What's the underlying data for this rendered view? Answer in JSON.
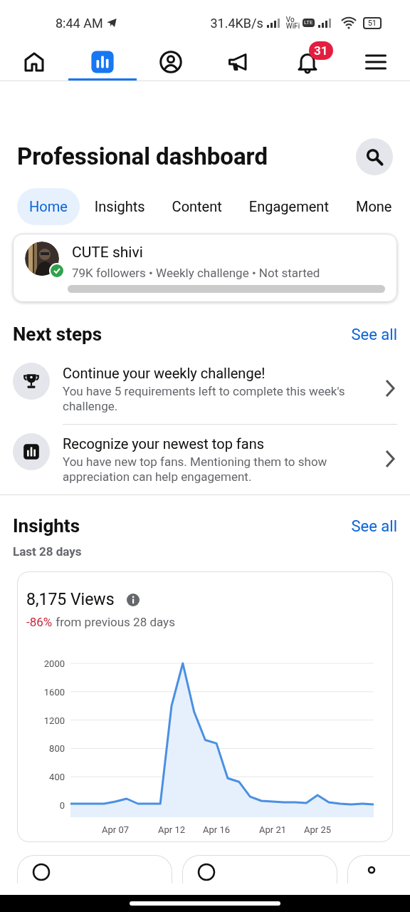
{
  "status_bar": {
    "time": "8:44 AM",
    "speed": "31.4KB/s",
    "vowifi_top": "Vo",
    "vowifi_bottom": "WiFi",
    "lte": "LTE",
    "battery": "51"
  },
  "nav": [
    {
      "kind": "home",
      "selected": false
    },
    {
      "kind": "dashboard",
      "selected": true
    },
    {
      "kind": "profile",
      "selected": false
    },
    {
      "kind": "megaphone",
      "selected": false
    },
    {
      "kind": "bell",
      "selected": false,
      "badge": "31"
    },
    {
      "kind": "menu",
      "selected": false
    }
  ],
  "title": "Professional dashboard",
  "tabs": [
    {
      "label": "Home",
      "selected": true
    },
    {
      "label": "Insights",
      "selected": false
    },
    {
      "label": "Content",
      "selected": false
    },
    {
      "label": "Engagement",
      "selected": false
    },
    {
      "label": "Mone",
      "selected": false
    }
  ],
  "profile": {
    "name": "CUTE shivi",
    "details": "79K followers • Weekly challenge • Not started",
    "verified": true
  },
  "next_steps": {
    "title": "Next steps",
    "link": "See all",
    "items": [
      {
        "kind": "trophy",
        "title": "Continue your weekly challenge!",
        "text": "You have 5 requirements left to complete this week's challenge."
      },
      {
        "kind": "chart",
        "title": "Recognize your newest top fans",
        "text": "You have new top fans. Mentioning them to show appreciation can help engagement."
      }
    ]
  },
  "insights": {
    "title": "Insights",
    "link": "See all",
    "period": "Last 28 days",
    "views": "8,175 Views",
    "change": "-86%",
    "change_text": "from previous 28 days",
    "chart_data": {
      "type": "area",
      "categories": [
        null,
        null,
        null,
        null,
        "Apr 07",
        null,
        null,
        null,
        null,
        "Apr 12",
        null,
        null,
        null,
        "Apr 16",
        null,
        null,
        null,
        null,
        "Apr 21",
        null,
        null,
        null,
        "Apr 25",
        null,
        null,
        null,
        null,
        null
      ],
      "series": [
        {
          "color": "#4a90e2",
          "values": [
            20,
            20,
            20,
            20,
            50,
            90,
            20,
            20,
            20,
            1400,
            2000,
            1320,
            920,
            870,
            380,
            330,
            120,
            60,
            50,
            40,
            40,
            30,
            140,
            40,
            20,
            10,
            20,
            10
          ]
        }
      ],
      "ylim": [
        0,
        2000
      ],
      "grid": true,
      "yticks": [
        0,
        400,
        800,
        1200,
        1600,
        2000
      ]
    }
  },
  "bottom_cards": [
    {
      "kind": "clock"
    },
    {
      "kind": "clock"
    },
    {
      "kind": "person"
    }
  ]
}
